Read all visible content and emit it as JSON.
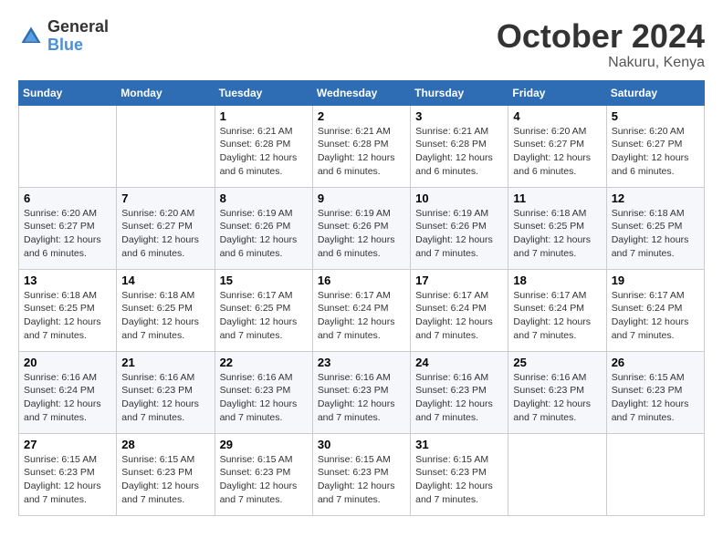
{
  "header": {
    "logo_general": "General",
    "logo_blue": "Blue",
    "month": "October 2024",
    "location": "Nakuru, Kenya"
  },
  "days_of_week": [
    "Sunday",
    "Monday",
    "Tuesday",
    "Wednesday",
    "Thursday",
    "Friday",
    "Saturday"
  ],
  "weeks": [
    [
      {
        "day": "",
        "info": ""
      },
      {
        "day": "",
        "info": ""
      },
      {
        "day": "1",
        "sunrise": "6:21 AM",
        "sunset": "6:28 PM",
        "daylight": "12 hours and 6 minutes."
      },
      {
        "day": "2",
        "sunrise": "6:21 AM",
        "sunset": "6:28 PM",
        "daylight": "12 hours and 6 minutes."
      },
      {
        "day": "3",
        "sunrise": "6:21 AM",
        "sunset": "6:28 PM",
        "daylight": "12 hours and 6 minutes."
      },
      {
        "day": "4",
        "sunrise": "6:20 AM",
        "sunset": "6:27 PM",
        "daylight": "12 hours and 6 minutes."
      },
      {
        "day": "5",
        "sunrise": "6:20 AM",
        "sunset": "6:27 PM",
        "daylight": "12 hours and 6 minutes."
      }
    ],
    [
      {
        "day": "6",
        "sunrise": "6:20 AM",
        "sunset": "6:27 PM",
        "daylight": "12 hours and 6 minutes."
      },
      {
        "day": "7",
        "sunrise": "6:20 AM",
        "sunset": "6:27 PM",
        "daylight": "12 hours and 6 minutes."
      },
      {
        "day": "8",
        "sunrise": "6:19 AM",
        "sunset": "6:26 PM",
        "daylight": "12 hours and 6 minutes."
      },
      {
        "day": "9",
        "sunrise": "6:19 AM",
        "sunset": "6:26 PM",
        "daylight": "12 hours and 6 minutes."
      },
      {
        "day": "10",
        "sunrise": "6:19 AM",
        "sunset": "6:26 PM",
        "daylight": "12 hours and 7 minutes."
      },
      {
        "day": "11",
        "sunrise": "6:18 AM",
        "sunset": "6:25 PM",
        "daylight": "12 hours and 7 minutes."
      },
      {
        "day": "12",
        "sunrise": "6:18 AM",
        "sunset": "6:25 PM",
        "daylight": "12 hours and 7 minutes."
      }
    ],
    [
      {
        "day": "13",
        "sunrise": "6:18 AM",
        "sunset": "6:25 PM",
        "daylight": "12 hours and 7 minutes."
      },
      {
        "day": "14",
        "sunrise": "6:18 AM",
        "sunset": "6:25 PM",
        "daylight": "12 hours and 7 minutes."
      },
      {
        "day": "15",
        "sunrise": "6:17 AM",
        "sunset": "6:25 PM",
        "daylight": "12 hours and 7 minutes."
      },
      {
        "day": "16",
        "sunrise": "6:17 AM",
        "sunset": "6:24 PM",
        "daylight": "12 hours and 7 minutes."
      },
      {
        "day": "17",
        "sunrise": "6:17 AM",
        "sunset": "6:24 PM",
        "daylight": "12 hours and 7 minutes."
      },
      {
        "day": "18",
        "sunrise": "6:17 AM",
        "sunset": "6:24 PM",
        "daylight": "12 hours and 7 minutes."
      },
      {
        "day": "19",
        "sunrise": "6:17 AM",
        "sunset": "6:24 PM",
        "daylight": "12 hours and 7 minutes."
      }
    ],
    [
      {
        "day": "20",
        "sunrise": "6:16 AM",
        "sunset": "6:24 PM",
        "daylight": "12 hours and 7 minutes."
      },
      {
        "day": "21",
        "sunrise": "6:16 AM",
        "sunset": "6:23 PM",
        "daylight": "12 hours and 7 minutes."
      },
      {
        "day": "22",
        "sunrise": "6:16 AM",
        "sunset": "6:23 PM",
        "daylight": "12 hours and 7 minutes."
      },
      {
        "day": "23",
        "sunrise": "6:16 AM",
        "sunset": "6:23 PM",
        "daylight": "12 hours and 7 minutes."
      },
      {
        "day": "24",
        "sunrise": "6:16 AM",
        "sunset": "6:23 PM",
        "daylight": "12 hours and 7 minutes."
      },
      {
        "day": "25",
        "sunrise": "6:16 AM",
        "sunset": "6:23 PM",
        "daylight": "12 hours and 7 minutes."
      },
      {
        "day": "26",
        "sunrise": "6:15 AM",
        "sunset": "6:23 PM",
        "daylight": "12 hours and 7 minutes."
      }
    ],
    [
      {
        "day": "27",
        "sunrise": "6:15 AM",
        "sunset": "6:23 PM",
        "daylight": "12 hours and 7 minutes."
      },
      {
        "day": "28",
        "sunrise": "6:15 AM",
        "sunset": "6:23 PM",
        "daylight": "12 hours and 7 minutes."
      },
      {
        "day": "29",
        "sunrise": "6:15 AM",
        "sunset": "6:23 PM",
        "daylight": "12 hours and 7 minutes."
      },
      {
        "day": "30",
        "sunrise": "6:15 AM",
        "sunset": "6:23 PM",
        "daylight": "12 hours and 7 minutes."
      },
      {
        "day": "31",
        "sunrise": "6:15 AM",
        "sunset": "6:23 PM",
        "daylight": "12 hours and 7 minutes."
      },
      {
        "day": "",
        "info": ""
      },
      {
        "day": "",
        "info": ""
      }
    ]
  ]
}
